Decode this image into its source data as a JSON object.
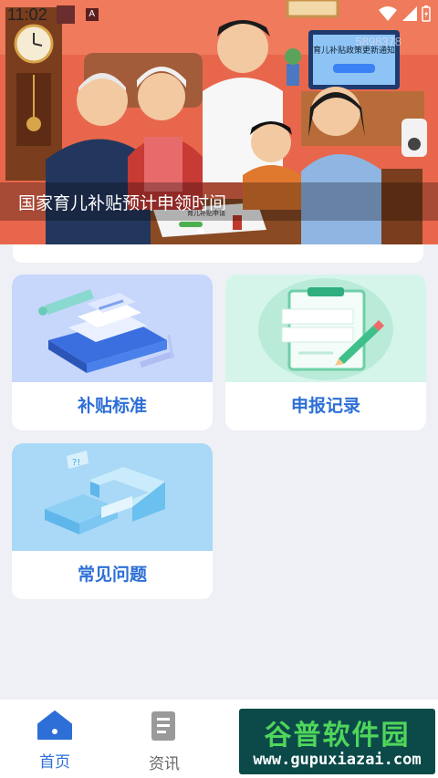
{
  "status_bar": {
    "time": "11:02",
    "icon_a": "A",
    "icons": [
      "wifi-icon",
      "signal-icon",
      "battery-icon"
    ]
  },
  "banner": {
    "caption": "国家育儿补贴预计申领时间",
    "tv_text": "育儿补贴政策更新通知",
    "watermark_num": "5898378",
    "paper_title": "育儿补贴申请",
    "slides_total": 1,
    "active_slide": 1
  },
  "cards": [
    {
      "label": "补贴标准",
      "icon": "document-stack-icon"
    },
    {
      "label": "申报记录",
      "icon": "clipboard-icon"
    },
    {
      "label": "常见问题",
      "icon": "question-mark-icon"
    }
  ],
  "nav": {
    "items": [
      {
        "label": "首页",
        "icon": "home-icon",
        "active": true
      },
      {
        "label": "资讯",
        "icon": "news-icon",
        "active": false
      }
    ]
  },
  "watermark": {
    "top": "谷普软件园",
    "bottom": "www.gupuxiazai.com"
  },
  "colors": {
    "accent": "#2d6fd6",
    "background": "#eef0f5",
    "banner_bg": "#e86a4e"
  }
}
